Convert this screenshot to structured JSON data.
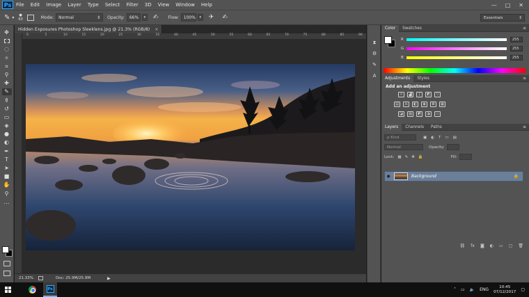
{
  "app": {
    "logo": "Ps",
    "menu": [
      "File",
      "Edit",
      "Image",
      "Layer",
      "Type",
      "Select",
      "Filter",
      "3D",
      "View",
      "Window",
      "Help"
    ],
    "window_controls": [
      "—",
      "□",
      "✕"
    ]
  },
  "options_bar": {
    "brush_size": "60",
    "mode_label": "Mode:",
    "mode_value": "Normal",
    "opacity_label": "Opacity:",
    "opacity_value": "66%",
    "flow_label": "Flow:",
    "flow_value": "100%",
    "workspace": "Essentials"
  },
  "document": {
    "tab_title": "Hidden Exposures Photoshop Sleeklens.jpg @ 21.3% (RGB/8)",
    "tab_close": "×",
    "ruler_marks": [
      "0",
      "5",
      "10",
      "15",
      "20",
      "25",
      "30",
      "35",
      "40",
      "45",
      "50",
      "55",
      "60",
      "65",
      "70",
      "75",
      "80",
      "85",
      "90"
    ],
    "zoom": "21.33%",
    "doc_size": "Doc: 25.9M/25.9M"
  },
  "panels": {
    "color": {
      "tabs": [
        "Color",
        "Swatches"
      ],
      "channels": [
        {
          "label": "R",
          "value": "255",
          "gradient": "linear-gradient(to right, #00ffff, #ffffff)"
        },
        {
          "label": "G",
          "value": "255",
          "gradient": "linear-gradient(to right, #ff00ff, #ffffff)"
        },
        {
          "label": "B",
          "value": "255",
          "gradient": "linear-gradient(to right, #ffff00, #ffffff)"
        }
      ]
    },
    "adjustments": {
      "tabs": [
        "Adjustments",
        "Styles"
      ],
      "title": "Add an adjustment"
    },
    "layers": {
      "tabs": [
        "Layers",
        "Channels",
        "Paths"
      ],
      "kind_label": "ρ Kind",
      "blend_mode": "Normal",
      "opacity_label": "Opacity:",
      "lock_label": "Lock:",
      "fill_label": "Fill:",
      "layer_name": "Background"
    }
  },
  "taskbar": {
    "language": "ENG",
    "time": "10:45",
    "date": "07/12/2017"
  },
  "colors": {
    "accent": "#31a8ff",
    "layer_selected": "#6b7f99",
    "ui_gray": "#535353"
  }
}
